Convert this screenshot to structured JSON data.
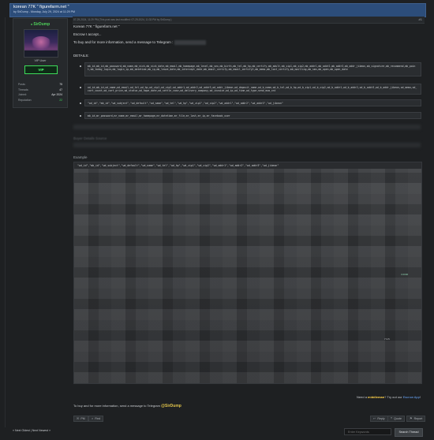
{
  "thread": {
    "title": "korean 77K \" figurefarm.net \"",
    "subtitle": "by SirDump - Monday, July 29, 2024 at 11:29 PM"
  },
  "post": {
    "date": "07-29-2024, 11:29 PM (This post was last modified: 07-29-2024, 11:33 PM by SirDump.)",
    "number": "#1",
    "line1": "Korean 77K \" figurefarm.net \"",
    "line2": "Escrow I accept...",
    "line3": "To buy and for more information, send a message to Telegram :",
    "details_label": "DETAILS:",
    "bullets": [
      "mb_id,mb_id,mb_password,mb_name,mb_nick,mb_nick_date,mb_email,mb_homepage,mb_level,mb_sex,mb_birth,mb_tel,mb_hp,mb_certify,mb_adult,mb_zip1,mb_zip2,mb_addr1,mb_addr2,mb_addr3,mb_addr_jibeon,mb_signature,mb_recommend,mb_point,mb_today_login,mb_login_ip,mb_datetime,mb_ip,mb_leave_date,mb_intercept_date,mb_email_certify,mb_email_certify2,mb_memo,mb_lost_certify,mb_mailling,mb_sms,mb_open,mb_open_date",
      "od_id,mb_id,od_name,od_email,od_tel,od_hp,od_zip1,od_zip2,od_addr1,od_addr2,od_addr3,od_addr_jibeon,od_deposit_name,od_b_name,od_b_tel,od_b_hp,od_b_zip1,od_b_zip2,od_b_addr1,od_b_addr2,od_b_addr3,od_b_addr_jibeon,od_memo,od_cart_count,od_cart_price,od_status,od_hope_date,od_settle_case,od_delivery_company,od_invoice,od_ip,od_time,od_type,send_msm_cnt",
      "\"wd_id\",\"mb_id\",\"wd_subject\",\"wd_default\",\"wd_name\",\"wd_tel\",\"wd_hp\",\"wd_zip1\",\"wd_zip2\",\"wd_addr1\",\"wd_addr2\",\"wd_addr3\",\"wd_jibeon\"",
      "mb_id,mr_password,mr_name,mr_email,mr_homepage,mr_datetime,mr_file,mr_last,mr_ip,mr_facebook_user"
    ],
    "hidden_label": "Buyer Details Source",
    "example_label": "Example",
    "example_first_line": "\"wd_id\",\"mb_id\",\"wd_subject\",\"wd_default\",\"wd_name\",\"wd_tel\",\"wd_hp\",\"wd_zip1\",\"wd_zip2\",\"wd_addr1\",\"wd_addr2\",\"wd_addr3\",\"wd_jibeon\"",
    "mark1": "3.0000",
    "mark2": "7.3.5",
    "midman_pre": "Need a ",
    "midman_bold": "middleman",
    "midman_mid": "? Try out our ",
    "midman_link": "Escrow App",
    "midman_post": "!",
    "signature_text": "To buy and for more information, send a message to Telegram ",
    "signature_name": "@SirDump"
  },
  "user": {
    "name": "SirDump",
    "rank": "VIP User",
    "badge": "VIP",
    "stats": [
      {
        "k": "Posts:",
        "v": "75"
      },
      {
        "k": "Threads:",
        "v": "47"
      },
      {
        "k": "Joined:",
        "v": "Apr 2024"
      },
      {
        "k": "Reputation:",
        "v": "22"
      }
    ]
  },
  "actions": {
    "pm": "PM",
    "find": "Find",
    "reply": "Reply",
    "quote": "Quote",
    "report": "Report"
  },
  "footer": {
    "next_oldest": "« Next Oldest",
    "separator": " | ",
    "next_newest": "Next Newest »",
    "search_placeholder": "Enter Keywords",
    "search_button": "Search Thread"
  }
}
